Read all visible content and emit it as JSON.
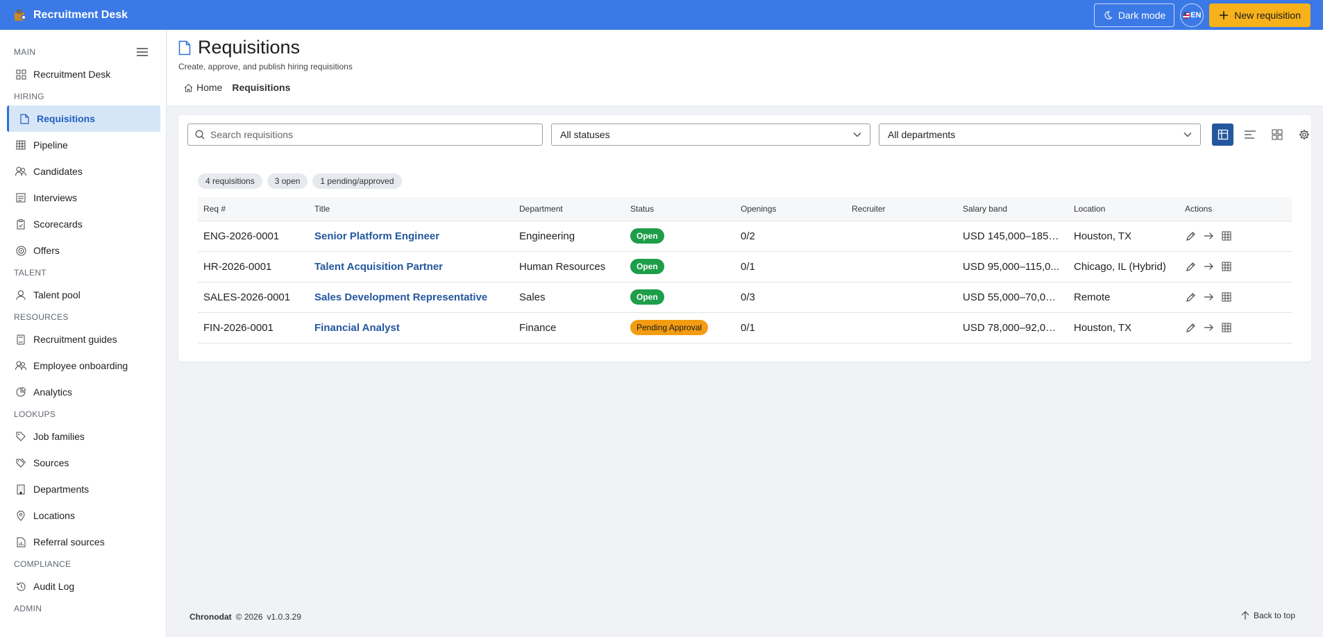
{
  "app": {
    "name": "Recruitment Desk",
    "dark_mode_label": "Dark mode",
    "lang_label": "EN",
    "new_button_label": "New requisition"
  },
  "sidebar": {
    "sections": [
      {
        "title": "MAIN",
        "items": [
          {
            "label": "Recruitment Desk",
            "icon": "dashboard-icon"
          }
        ]
      },
      {
        "title": "HIRING",
        "items": [
          {
            "label": "Requisitions",
            "icon": "document-icon",
            "active": true
          },
          {
            "label": "Pipeline",
            "icon": "table-icon"
          },
          {
            "label": "Candidates",
            "icon": "people-icon"
          },
          {
            "label": "Interviews",
            "icon": "list-icon"
          },
          {
            "label": "Scorecards",
            "icon": "clipboard-icon"
          },
          {
            "label": "Offers",
            "icon": "target-icon"
          }
        ]
      },
      {
        "title": "TALENT",
        "items": [
          {
            "label": "Talent pool",
            "icon": "person-icon"
          }
        ]
      },
      {
        "title": "RESOURCES",
        "items": [
          {
            "label": "Recruitment guides",
            "icon": "book-icon"
          },
          {
            "label": "Employee onboarding",
            "icon": "people-icon"
          },
          {
            "label": "Analytics",
            "icon": "chart-icon"
          }
        ]
      },
      {
        "title": "LOOKUPS",
        "items": [
          {
            "label": "Job families",
            "icon": "tag-icon"
          },
          {
            "label": "Sources",
            "icon": "tags-icon"
          },
          {
            "label": "Departments",
            "icon": "building-icon"
          },
          {
            "label": "Locations",
            "icon": "location-icon"
          },
          {
            "label": "Referral sources",
            "icon": "document-chart-icon"
          }
        ]
      },
      {
        "title": "COMPLIANCE",
        "items": [
          {
            "label": "Audit Log",
            "icon": "history-icon"
          }
        ]
      },
      {
        "title": "ADMIN",
        "items": []
      }
    ]
  },
  "page": {
    "title": "Requisitions",
    "subtitle": "Create, approve, and publish hiring requisitions",
    "breadcrumb_home": "Home",
    "breadcrumb_current": "Requisitions"
  },
  "filters": {
    "search_placeholder": "Search requisitions",
    "status_value": "All statuses",
    "department_value": "All departments"
  },
  "chips": [
    "4 requisitions",
    "3 open",
    "1 pending/approved"
  ],
  "table": {
    "columns": [
      "Req #",
      "Title",
      "Department",
      "Status",
      "Openings",
      "Recruiter",
      "Salary band",
      "Location",
      "Actions"
    ],
    "rows": [
      {
        "req": "ENG-2026-0001",
        "title": "Senior Platform Engineer",
        "department": "Engineering",
        "status": "Open",
        "status_kind": "open",
        "openings": "0/2",
        "recruiter": "",
        "salary": "USD 145,000–185,...",
        "location": "Houston, TX"
      },
      {
        "req": "HR-2026-0001",
        "title": "Talent Acquisition Partner",
        "department": "Human Resources",
        "status": "Open",
        "status_kind": "open",
        "openings": "0/1",
        "recruiter": "",
        "salary": "USD 95,000–115,0...",
        "location": "Chicago, IL (Hybrid)"
      },
      {
        "req": "SALES-2026-0001",
        "title": "Sales Development Representative",
        "department": "Sales",
        "status": "Open",
        "status_kind": "open",
        "openings": "0/3",
        "recruiter": "",
        "salary": "USD 55,000–70,00...",
        "location": "Remote"
      },
      {
        "req": "FIN-2026-0001",
        "title": "Financial Analyst",
        "department": "Finance",
        "status": "Pending Approval",
        "status_kind": "pending",
        "openings": "0/1",
        "recruiter": "",
        "salary": "USD 78,000–92,00...",
        "location": "Houston, TX"
      }
    ]
  },
  "footer": {
    "company": "Chronodat",
    "copyright": "© 2026",
    "version": "v1.0.3.29",
    "back_to_top": "Back to top"
  },
  "colors": {
    "topbar": "#3b79e6",
    "accent_button": "#f7b21b",
    "open_badge": "#1e9e4a",
    "pending_badge": "#f39c12",
    "link": "#24579e"
  }
}
